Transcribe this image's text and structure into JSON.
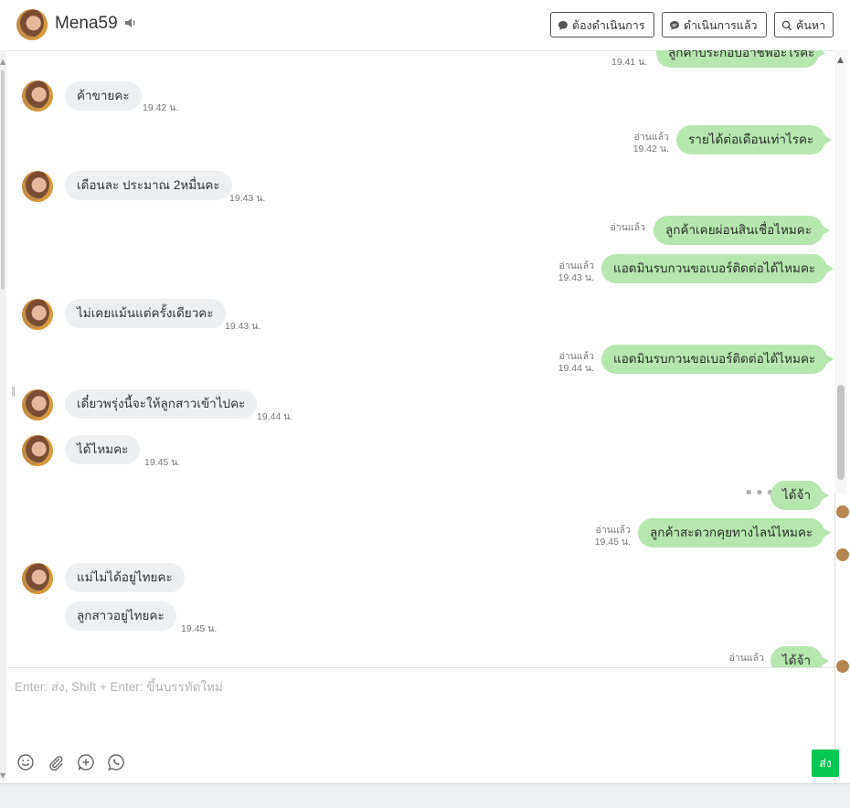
{
  "header": {
    "name": "Mena59",
    "btn_todo": "ต้องดำเนินการ",
    "btn_done": "ดำเนินการแล้ว",
    "btn_search": "ค้นหา"
  },
  "messages": {
    "m0_text": "ลูกค้าประกอบอาชีพอะไรคะ",
    "m0_time": "19.41 น.",
    "m1_text": "ค้าขายคะ",
    "m1_time": "19.42 น.",
    "m2_read": "อ่านแล้ว",
    "m2_time": "19.42 น.",
    "m2_text": "รายได้ต่อเดือนเท่าไรคะ",
    "m3_text": "เดือนละ ประมาณ 2หมื่นคะ",
    "m3_time": "19.43 น.",
    "m4_read": "อ่านแล้ว",
    "m4_text": "ลูกค้าเคยผ่อนสินเชื่อไหมคะ",
    "m5_read": "อ่านแล้ว",
    "m5_time": "19.43 น.",
    "m5_text": "แอดมินรบกวนขอเบอร์ติดต่อได้ไหมคะ",
    "m6_text": "ไม่เคยแม้นแต่ครั้งเดียวคะ",
    "m6_time": "19.43 น.",
    "m7_read": "อ่านแล้ว",
    "m7_time": "19.44 น.",
    "m7_text": "แอดมินรบกวนขอเบอร์ติดต่อได้ไหมคะ",
    "m8_text": "เดี๋ยวพรุ่งนี้จะให้ลูกสาวเข้าไปคะ",
    "m8_time": "19.44 น.",
    "m9_text": "ได้ไหมคะ",
    "m9_time": "19.45 น.",
    "m10_text": "ได้จ้า",
    "m11_read": "อ่านแล้ว",
    "m11_time": "19.45 น.",
    "m11_text": "ลูกค้าสะดวกคุยทางไลน์ไหมคะ",
    "m12_text": "แม่ไม่ได้อยู่ไทยคะ",
    "m13_text": "ลูกสาวอยู่ไทยคะ",
    "m13_time": "19.45 น.",
    "m14_read": "อ่านแล้ว",
    "m14_text": "ได้จ้า"
  },
  "composer": {
    "placeholder": "Enter: ส่ง, Shift + Enter: ขึ้นบรรทัดใหม่",
    "send_label": "ส่ง"
  },
  "colors": {
    "outgoing_bubble": "#b7e6b0",
    "incoming_bubble": "#eeeff1",
    "send_button": "#06c755"
  },
  "icons": [
    "speaker-icon",
    "chat-bubble-icon",
    "search-icon",
    "emoji-icon",
    "attach-icon",
    "add-icon",
    "whatsapp-icon",
    "typing-dots-icon"
  ]
}
